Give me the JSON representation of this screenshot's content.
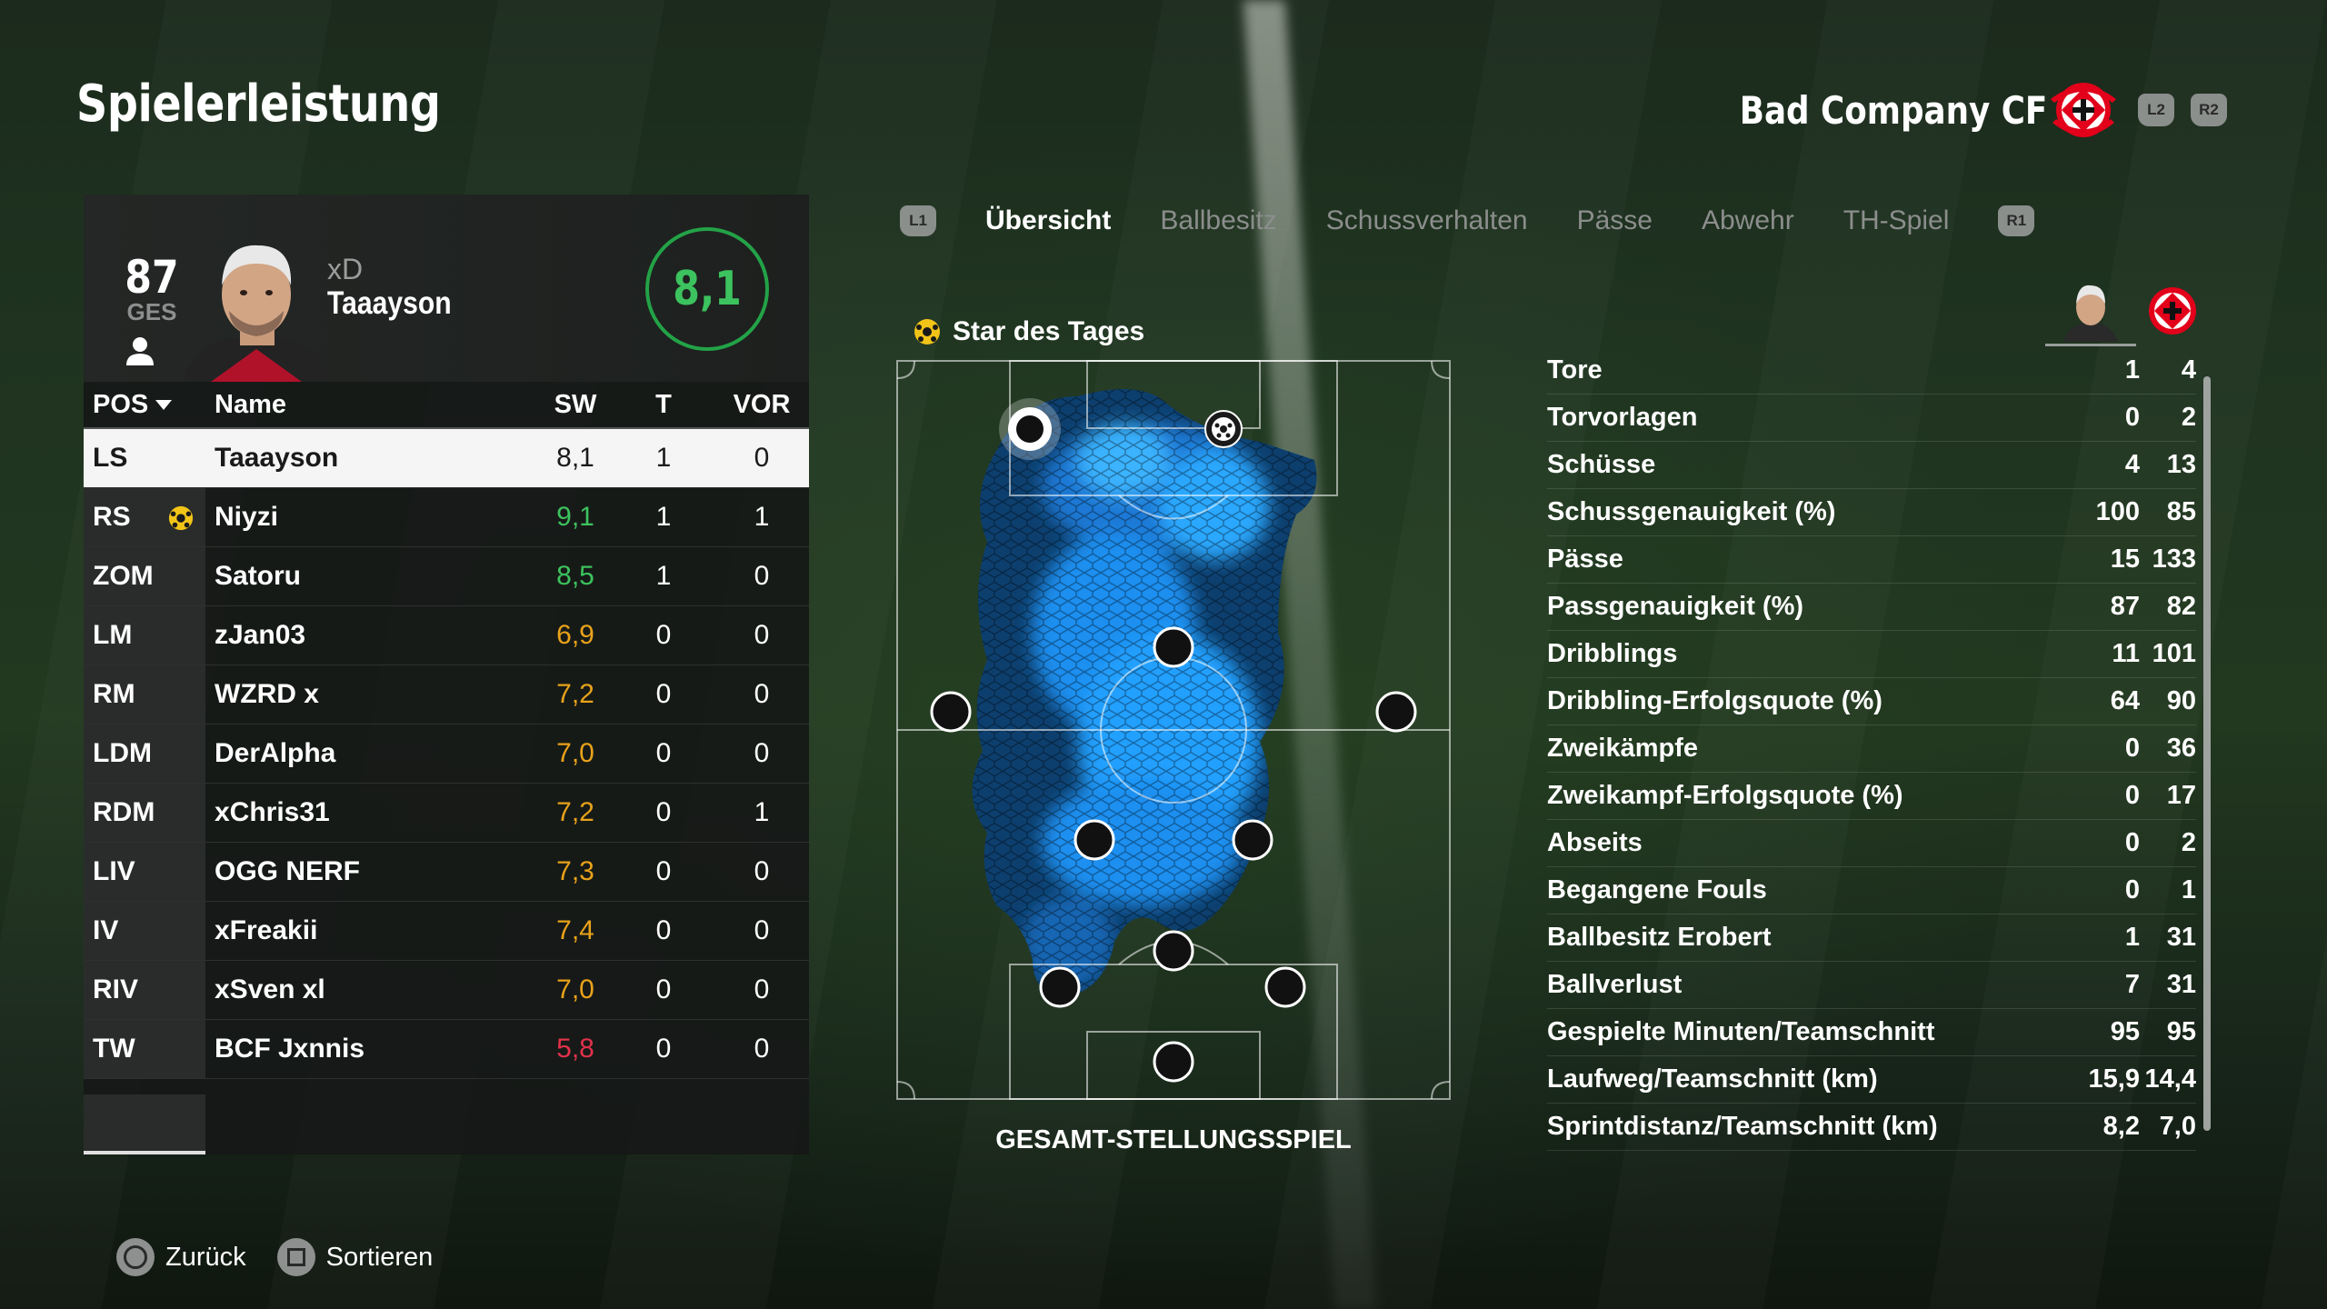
{
  "page_title": "Spielerleistung",
  "team": {
    "name": "Bad Company CF",
    "l2": "L2",
    "r2": "R2"
  },
  "player": {
    "overall": "87",
    "overall_label": "GES",
    "name_small": "xD",
    "name": "Taaayson",
    "rating": "8,1"
  },
  "table": {
    "headers": {
      "pos": "POS",
      "name": "Name",
      "sw": "SW",
      "t": "T",
      "vor": "VOR"
    },
    "rows": [
      {
        "pos": "LS",
        "name": "Taaayson",
        "sw": "8,1",
        "t": "1",
        "vor": "0",
        "color": "dark",
        "star": false
      },
      {
        "pos": "RS",
        "name": "Niyzi",
        "sw": "9,1",
        "t": "1",
        "vor": "1",
        "color": "green",
        "star": true
      },
      {
        "pos": "ZOM",
        "name": "Satoru",
        "sw": "8,5",
        "t": "1",
        "vor": "0",
        "color": "green",
        "star": false
      },
      {
        "pos": "LM",
        "name": "zJan03",
        "sw": "6,9",
        "t": "0",
        "vor": "0",
        "color": "orange",
        "star": false
      },
      {
        "pos": "RM",
        "name": "WZRD x",
        "sw": "7,2",
        "t": "0",
        "vor": "0",
        "color": "orange",
        "star": false
      },
      {
        "pos": "LDM",
        "name": "DerAlpha",
        "sw": "7,0",
        "t": "0",
        "vor": "0",
        "color": "orange",
        "star": false
      },
      {
        "pos": "RDM",
        "name": "xChris31",
        "sw": "7,2",
        "t": "0",
        "vor": "1",
        "color": "orange",
        "star": false
      },
      {
        "pos": "LIV",
        "name": "OGG NERF",
        "sw": "7,3",
        "t": "0",
        "vor": "0",
        "color": "orange",
        "star": false
      },
      {
        "pos": "IV",
        "name": "xFreakii",
        "sw": "7,4",
        "t": "0",
        "vor": "0",
        "color": "orange",
        "star": false
      },
      {
        "pos": "RIV",
        "name": "xSven xl",
        "sw": "7,0",
        "t": "0",
        "vor": "0",
        "color": "orange",
        "star": false
      },
      {
        "pos": "TW",
        "name": "BCF Jxnnis",
        "sw": "5,8",
        "t": "0",
        "vor": "0",
        "color": "red",
        "star": false
      }
    ]
  },
  "tabs": {
    "l1": "L1",
    "r1": "R1",
    "items": [
      "Übersicht",
      "Ballbesitz",
      "Schussverhalten",
      "Pässe",
      "Abwehr",
      "TH-Spiel"
    ],
    "active": 0
  },
  "star_of_day": "Star des Tages",
  "heatmap_title": "GESAMT-STELLUNGSSPIEL",
  "stats": [
    {
      "label": "Tore",
      "player": "1",
      "team": "4"
    },
    {
      "label": "Torvorlagen",
      "player": "0",
      "team": "2"
    },
    {
      "label": "Schüsse",
      "player": "4",
      "team": "13"
    },
    {
      "label": "Schussgenauigkeit (%)",
      "player": "100",
      "team": "85"
    },
    {
      "label": "Pässe",
      "player": "15",
      "team": "133"
    },
    {
      "label": "Passgenauigkeit (%)",
      "player": "87",
      "team": "82"
    },
    {
      "label": "Dribblings",
      "player": "11",
      "team": "101"
    },
    {
      "label": "Dribbling-Erfolgsquote (%)",
      "player": "64",
      "team": "90"
    },
    {
      "label": "Zweikämpfe",
      "player": "0",
      "team": "36"
    },
    {
      "label": "Zweikampf-Erfolgsquote (%)",
      "player": "0",
      "team": "17"
    },
    {
      "label": "Abseits",
      "player": "0",
      "team": "2"
    },
    {
      "label": "Begangene Fouls",
      "player": "0",
      "team": "1"
    },
    {
      "label": "Ballbesitz Erobert",
      "player": "1",
      "team": "31"
    },
    {
      "label": "Ballverlust",
      "player": "7",
      "team": "31"
    },
    {
      "label": "Gespielte Minuten/Teamschnitt",
      "player": "95",
      "team": "95"
    },
    {
      "label": "Laufweg/Teamschnitt (km)",
      "player": "15,9",
      "team": "14,4"
    },
    {
      "label": "Sprintdistanz/Teamschnitt (km)",
      "player": "8,2",
      "team": "7,0"
    }
  ],
  "footer": {
    "back": "Zurück",
    "sort": "Sortieren"
  },
  "colors": {
    "accent_green": "#3cc25e",
    "orange": "#e8a21a",
    "red": "#e0314b",
    "heat": "#1e9bff"
  }
}
